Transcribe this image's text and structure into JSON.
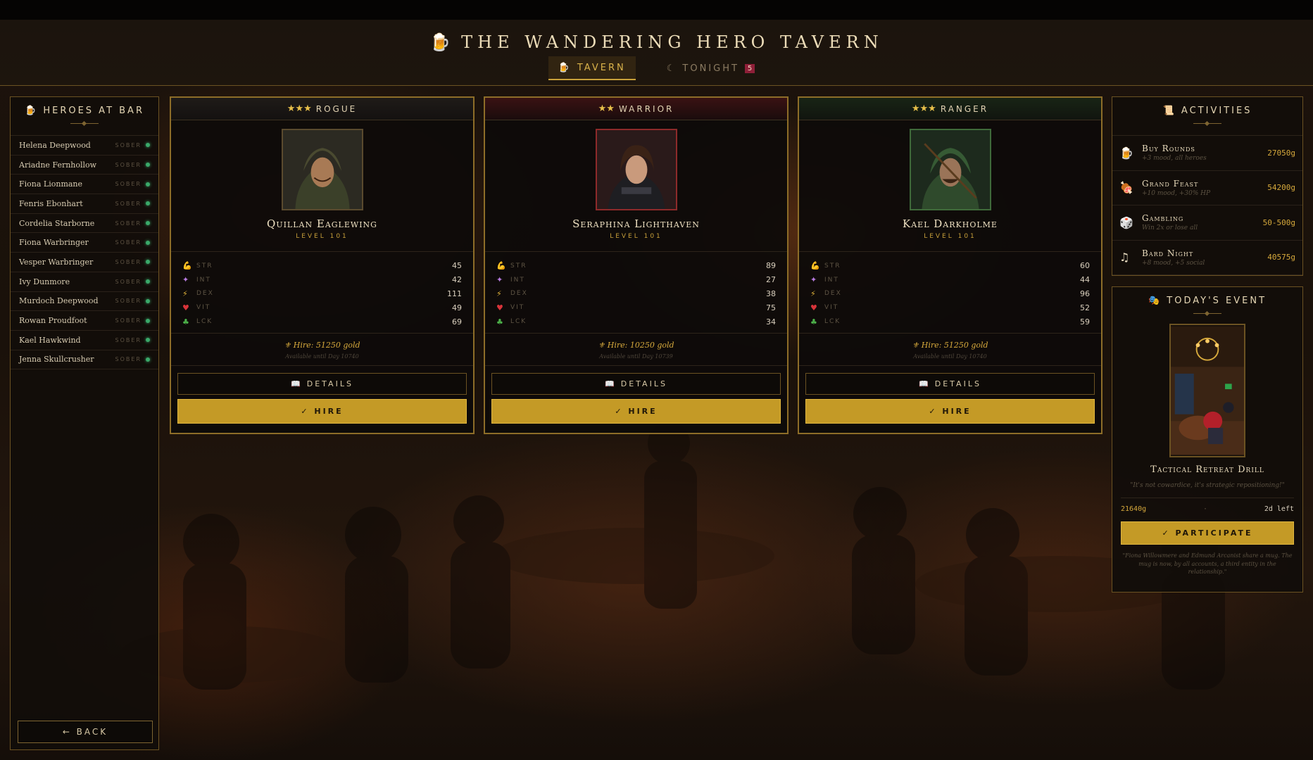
{
  "header": {
    "title": "THE WANDERING HERO TAVERN",
    "title_icon": "beer-mug-icon",
    "tabs": [
      {
        "label": "TAVERN",
        "icon": "beer-mug-icon",
        "active": true
      },
      {
        "label": "TONIGHT",
        "icon": "moon-icon",
        "badge": "5"
      }
    ]
  },
  "sidebar": {
    "title": "HEROES AT BAR",
    "icon": "beer-mug-icon",
    "heroes": [
      {
        "name": "Helena Deepwood",
        "status": "SOBER"
      },
      {
        "name": "Ariadne Fernhollow",
        "status": "SOBER"
      },
      {
        "name": "Fiona Lionmane",
        "status": "SOBER"
      },
      {
        "name": "Fenris Ebonhart",
        "status": "SOBER"
      },
      {
        "name": "Cordelia Starborne",
        "status": "SOBER"
      },
      {
        "name": "Fiona Warbringer",
        "status": "SOBER"
      },
      {
        "name": "Vesper Warbringer",
        "status": "SOBER"
      },
      {
        "name": "Ivy Dunmore",
        "status": "SOBER"
      },
      {
        "name": "Murdoch Deepwood",
        "status": "SOBER"
      },
      {
        "name": "Rowan Proudfoot",
        "status": "SOBER"
      },
      {
        "name": "Kael Hawkwind",
        "status": "SOBER"
      },
      {
        "name": "Jenna Skullcrusher",
        "status": "SOBER"
      }
    ],
    "back_label": "← BACK"
  },
  "cards": [
    {
      "stars": "★★★",
      "class": "ROGUE",
      "name": "Quillan Eaglewing",
      "level": "LEVEL 101",
      "stats": [
        {
          "label": "STR",
          "value": "45"
        },
        {
          "label": "INT",
          "value": "42"
        },
        {
          "label": "DEX",
          "value": "111"
        },
        {
          "label": "VIT",
          "value": "49"
        },
        {
          "label": "LCK",
          "value": "69"
        }
      ],
      "hire": "⚜ Hire: 51250 gold",
      "available": "Available until Day 10740",
      "details_label": "DETAILS",
      "hire_label": "✓ HIRE"
    },
    {
      "stars": "★★",
      "class": "WARRIOR",
      "name": "Seraphina Lighthaven",
      "level": "LEVEL 101",
      "stats": [
        {
          "label": "STR",
          "value": "89"
        },
        {
          "label": "INT",
          "value": "27"
        },
        {
          "label": "DEX",
          "value": "38"
        },
        {
          "label": "VIT",
          "value": "75"
        },
        {
          "label": "LCK",
          "value": "34"
        }
      ],
      "hire": "⚜ Hire: 10250 gold",
      "available": "Available until Day 10739",
      "details_label": "DETAILS",
      "hire_label": "✓ HIRE"
    },
    {
      "stars": "★★★",
      "class": "RANGER",
      "name": "Kael Darkholme",
      "level": "LEVEL 101",
      "stats": [
        {
          "label": "STR",
          "value": "60"
        },
        {
          "label": "INT",
          "value": "44"
        },
        {
          "label": "DEX",
          "value": "96"
        },
        {
          "label": "VIT",
          "value": "52"
        },
        {
          "label": "LCK",
          "value": "59"
        }
      ],
      "hire": "⚜ Hire: 51250 gold",
      "available": "Available until Day 10740",
      "details_label": "DETAILS",
      "hire_label": "✓ HIRE"
    }
  ],
  "stat_icons": {
    "STR": "💪",
    "INT": "✦",
    "DEX": "⚡",
    "VIT": "♥",
    "LCK": "♣"
  },
  "activities": {
    "title": "ACTIVITIES",
    "icon": "scroll-icon",
    "items": [
      {
        "name": "Buy Rounds",
        "desc": "+3 mood, all heroes",
        "price": "27050g",
        "icon": "beer-mug-icon"
      },
      {
        "name": "Grand Feast",
        "desc": "+10 mood, +30% HP",
        "price": "54200g",
        "icon": "meat-icon"
      },
      {
        "name": "Gambling",
        "desc": "Win 2x or lose all",
        "price": "50-500g",
        "icon": "dice-icon"
      },
      {
        "name": "Bard Night",
        "desc": "+8 mood, +5 social",
        "price": "40575g",
        "icon": "music-note-icon"
      }
    ]
  },
  "event": {
    "title": "TODAY'S EVENT",
    "icon": "theater-masks-icon",
    "name": "Tactical Retreat Drill",
    "quote": "\"It's not cowardice, it's strategic repositioning!\"",
    "cost": "21640g",
    "separator": "·",
    "time_left": "2d left",
    "participate_label": "✓ PARTICIPATE",
    "footer": "\"Fiona Willowmere and Edmund Arcanist share a mug. The mug is now, by all accounts, a third entity in the relationship.\""
  },
  "colors": {
    "accent": "#c49a26",
    "border": "#8d6d28",
    "sober": "#3aa96a",
    "badge": "#8e1f38"
  }
}
